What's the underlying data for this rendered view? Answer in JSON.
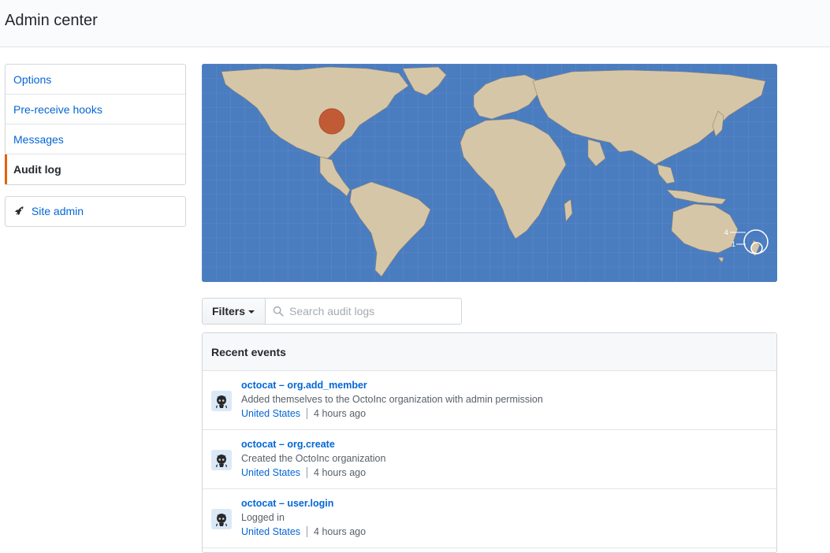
{
  "header": {
    "title": "Admin center"
  },
  "sidebar": {
    "items": [
      {
        "label": "Options"
      },
      {
        "label": "Pre-receive hooks"
      },
      {
        "label": "Messages"
      },
      {
        "label": "Audit log"
      }
    ],
    "selected": "Audit log",
    "site_admin_label": "Site admin"
  },
  "map": {
    "ocean_color": "#4a7cc0",
    "land_color": "#d6c6a8",
    "marker_color": "#c0522d",
    "cluster_labels": [
      "4",
      "1"
    ]
  },
  "toolbar": {
    "filters_label": "Filters",
    "search_placeholder": "Search audit logs"
  },
  "events": {
    "heading": "Recent events",
    "items": [
      {
        "title": "octocat – org.add_member",
        "description": "Added themselves to the OctoInc organization with admin permission",
        "location": "United States",
        "time": "4 hours ago"
      },
      {
        "title": "octocat – org.create",
        "description": "Created the OctoInc organization",
        "location": "United States",
        "time": "4 hours ago"
      },
      {
        "title": "octocat – user.login",
        "description": "Logged in",
        "location": "United States",
        "time": "4 hours ago"
      }
    ]
  }
}
